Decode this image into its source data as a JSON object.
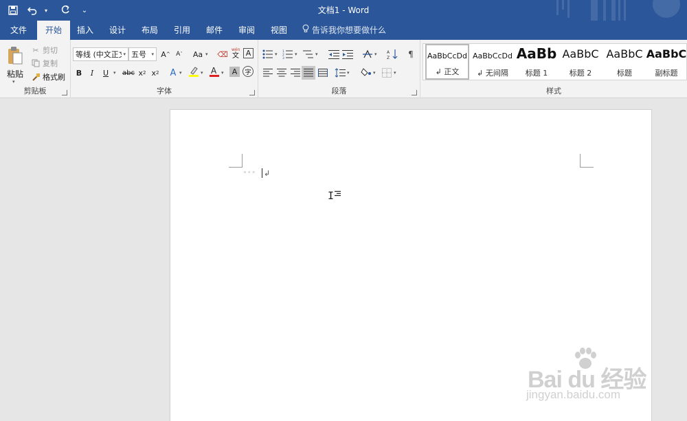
{
  "window": {
    "title": "文档1  -  Word",
    "accent_color": "#2b579a"
  },
  "quick_access": {
    "save_icon": "save-icon",
    "undo_icon": "undo-icon",
    "redo_icon": "redo-icon",
    "customize_icon": "customize-qat-icon"
  },
  "tabs": [
    "文件",
    "开始",
    "插入",
    "设计",
    "布局",
    "引用",
    "邮件",
    "审阅",
    "视图"
  ],
  "active_tab": "开始",
  "tell_me": "告诉我你想要做什么",
  "clipboard": {
    "paste": "粘贴",
    "cut": "剪切",
    "copy": "复制",
    "format_painter": "格式刷",
    "label": "剪贴板"
  },
  "font": {
    "font_name": "等线 (中文正文",
    "font_size": "五号",
    "label": "字体"
  },
  "paragraph": {
    "label": "段落"
  },
  "styles": {
    "label": "样式",
    "items": [
      {
        "sample": "AaBbCcDd",
        "name": "↲ 正文"
      },
      {
        "sample": "AaBbCcDd",
        "name": "↲ 无间隔"
      },
      {
        "sample": "AaBb",
        "name": "标题 1"
      },
      {
        "sample": "AaBbC",
        "name": "标题 2"
      },
      {
        "sample": "AaBbC",
        "name": "标题"
      },
      {
        "sample": "AaBbC",
        "name": "副标题"
      }
    ]
  },
  "document": {
    "paragraph_mark": "↲"
  },
  "watermark": {
    "logo": "Bai du 经验",
    "url": "jingyan.baidu.com"
  }
}
